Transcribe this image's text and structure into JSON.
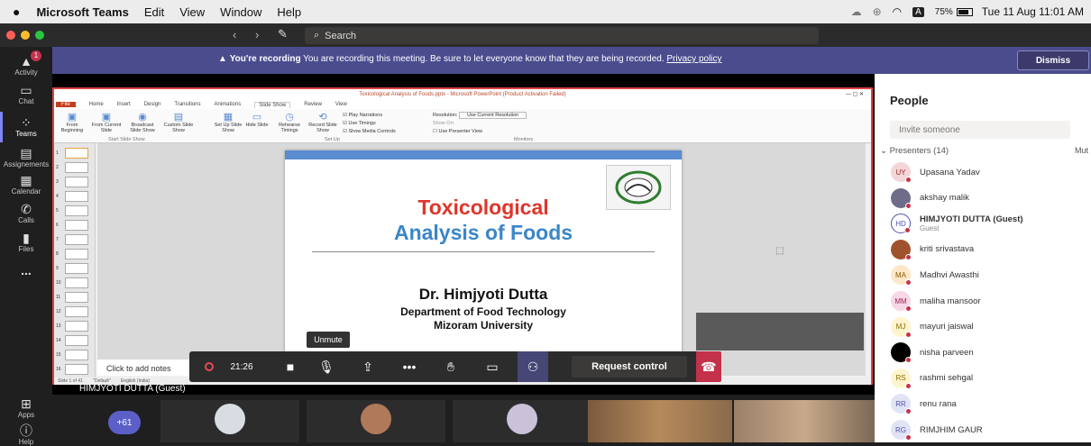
{
  "menubar": {
    "apple": "",
    "app_name": "Microsoft Teams",
    "items": [
      "Edit",
      "View",
      "Window",
      "Help"
    ],
    "battery": "75%",
    "datetime": "Tue 11 Aug  11:01 AM",
    "input_indicator": "A"
  },
  "titlebar": {
    "search_placeholder": "Search"
  },
  "rail": {
    "items": [
      {
        "label": "Activity",
        "icon": "bell-icon",
        "badge": "1"
      },
      {
        "label": "Chat",
        "icon": "chat-icon"
      },
      {
        "label": "Teams",
        "icon": "teams-icon"
      },
      {
        "label": "Assignements",
        "icon": "assignments-icon"
      },
      {
        "label": "Calendar",
        "icon": "calendar-icon"
      },
      {
        "label": "Calls",
        "icon": "phone-icon"
      },
      {
        "label": "Files",
        "icon": "file-icon"
      },
      {
        "label": "...",
        "icon": "more-icon"
      },
      {
        "label": "Apps",
        "icon": "apps-icon"
      },
      {
        "label": "Help",
        "icon": "help-icon"
      }
    ]
  },
  "banner": {
    "title": "You're recording",
    "message": "You are recording this meeting. Be sure to let everyone know that they are being recorded.",
    "link": "Privacy policy",
    "dismiss": "Dismiss"
  },
  "ppt": {
    "window_title": "Toxicological Analysis of Foods.pptx - Microsoft PowerPoint (Product Activation Failed)",
    "tabs": [
      "File",
      "Home",
      "Insert",
      "Design",
      "Transitions",
      "Animations",
      "Slide Show",
      "Review",
      "View"
    ],
    "active_tab": "Slide Show",
    "ribbon_buttons": [
      {
        "label": "From Beginning"
      },
      {
        "label": "From Current Slide"
      },
      {
        "label": "Broadcast Slide Show"
      },
      {
        "label": "Custom Slide Show"
      },
      {
        "label": "Set Up Slide Show"
      },
      {
        "label": "Hide Slide"
      },
      {
        "label": "Rehearse Timings"
      },
      {
        "label": "Record Slide Show"
      }
    ],
    "checkboxes": [
      "Play Narrations",
      "Use Timings",
      "Show Media Controls"
    ],
    "resolution_label": "Resolution:",
    "resolution_value": "Use Current Resolution",
    "show_on": "Show On:",
    "use_presenter_view": "Use Presenter View",
    "groups": [
      "Start Slide Show",
      "Set Up",
      "Monitors"
    ],
    "slide_numbers": [
      "1",
      "2",
      "3",
      "4",
      "5",
      "6",
      "7",
      "8",
      "9",
      "10",
      "11",
      "12",
      "13",
      "14",
      "15",
      "16"
    ],
    "notes_placeholder": "Click to add notes",
    "status_left": "Slide 1 of 41",
    "status_theme": "\"Default\"",
    "status_lang": "English (India)"
  },
  "slide": {
    "title_line1": "Toxicological",
    "title_line2": "Analysis of Foods",
    "author": "Dr. Himjyoti Dutta",
    "department": "Department of Food Technology",
    "university": "Mizoram University"
  },
  "controls": {
    "timer": "21:26",
    "tooltip": "Unmute",
    "request_control": "Request control"
  },
  "presenter_label": "HIMJYOTI DUTTA (Guest)",
  "bottom": {
    "overflow_count": "+61"
  },
  "people": {
    "title": "People",
    "invite_placeholder": "Invite someone",
    "presenters_label": "Presenters (14)",
    "mute_all": "Mut",
    "list": [
      {
        "initials": "UY",
        "name": "Upasana Yadav",
        "color": "#f3d6d8",
        "fg": "#a4262c",
        "photo": false
      },
      {
        "initials": "",
        "name": "akshay malik",
        "color": "#6d6d8a",
        "fg": "#fff",
        "photo": true
      },
      {
        "initials": "HD",
        "name": "HIMJYOTI DUTTA (Guest)",
        "sub": "Guest",
        "color": "#ffffff",
        "fg": "#4f52b2",
        "photo": false
      },
      {
        "initials": "",
        "name": "kriti srivastava",
        "color": "#a0522d",
        "fg": "#fff",
        "photo": true
      },
      {
        "initials": "MA",
        "name": "Madhvi Awasthi",
        "color": "#fde7c9",
        "fg": "#8a5a00",
        "photo": false
      },
      {
        "initials": "MM",
        "name": "maliha mansoor",
        "color": "#f6d7e6",
        "fg": "#a0245e",
        "photo": false
      },
      {
        "initials": "MJ",
        "name": "mayuri jaiswal",
        "color": "#fff4ce",
        "fg": "#8a6d00",
        "photo": false
      },
      {
        "initials": "",
        "name": "nisha parveen",
        "color": "#000000",
        "fg": "#fff",
        "photo": true
      },
      {
        "initials": "RS",
        "name": "rashmi sehgal",
        "color": "#fff4ce",
        "fg": "#8a6d00",
        "photo": false
      },
      {
        "initials": "RR",
        "name": "renu rana",
        "color": "#e1e4f5",
        "fg": "#4f52b2",
        "photo": false
      },
      {
        "initials": "RG",
        "name": "RIMJHIM GAUR",
        "color": "#e1e4f5",
        "fg": "#4f52b2",
        "photo": false
      }
    ]
  }
}
